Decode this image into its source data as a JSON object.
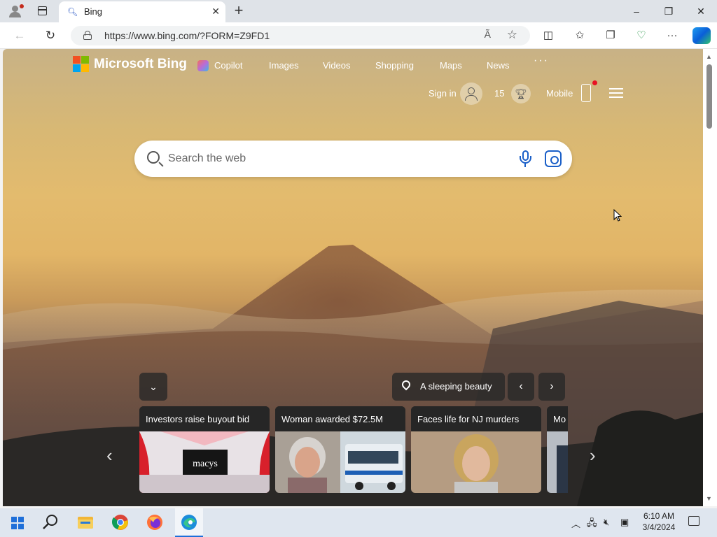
{
  "browser": {
    "tab_title": "Bing",
    "url": "https://www.bing.com/?FORM=Z9FD1",
    "read_aloud_label": "Ã",
    "controls": {
      "minimize": "–",
      "restore": "❐",
      "close": "✕"
    }
  },
  "bing": {
    "logo_text": "Microsoft Bing",
    "nav": [
      "Copilot",
      "Images",
      "Videos",
      "Shopping",
      "Maps",
      "News"
    ],
    "more": "···",
    "sign_in": "Sign in",
    "points": "15",
    "mobile": "Mobile",
    "search_placeholder": "Search the web",
    "image_title": "A sleeping beauty",
    "cards": [
      {
        "title": "Investors raise buyout bid",
        "brand": "macys"
      },
      {
        "title": "Woman awarded $72.5M"
      },
      {
        "title": "Faces life for NJ murders"
      },
      {
        "title": "Mo"
      }
    ]
  },
  "taskbar": {
    "time": "6:10 AM",
    "date": "3/4/2024"
  },
  "colors": {
    "accent_blue": "#1a5fc8",
    "logo_red": "#f25022",
    "logo_green": "#7fba00",
    "logo_blue": "#00a4ef",
    "logo_yellow": "#ffb900"
  }
}
